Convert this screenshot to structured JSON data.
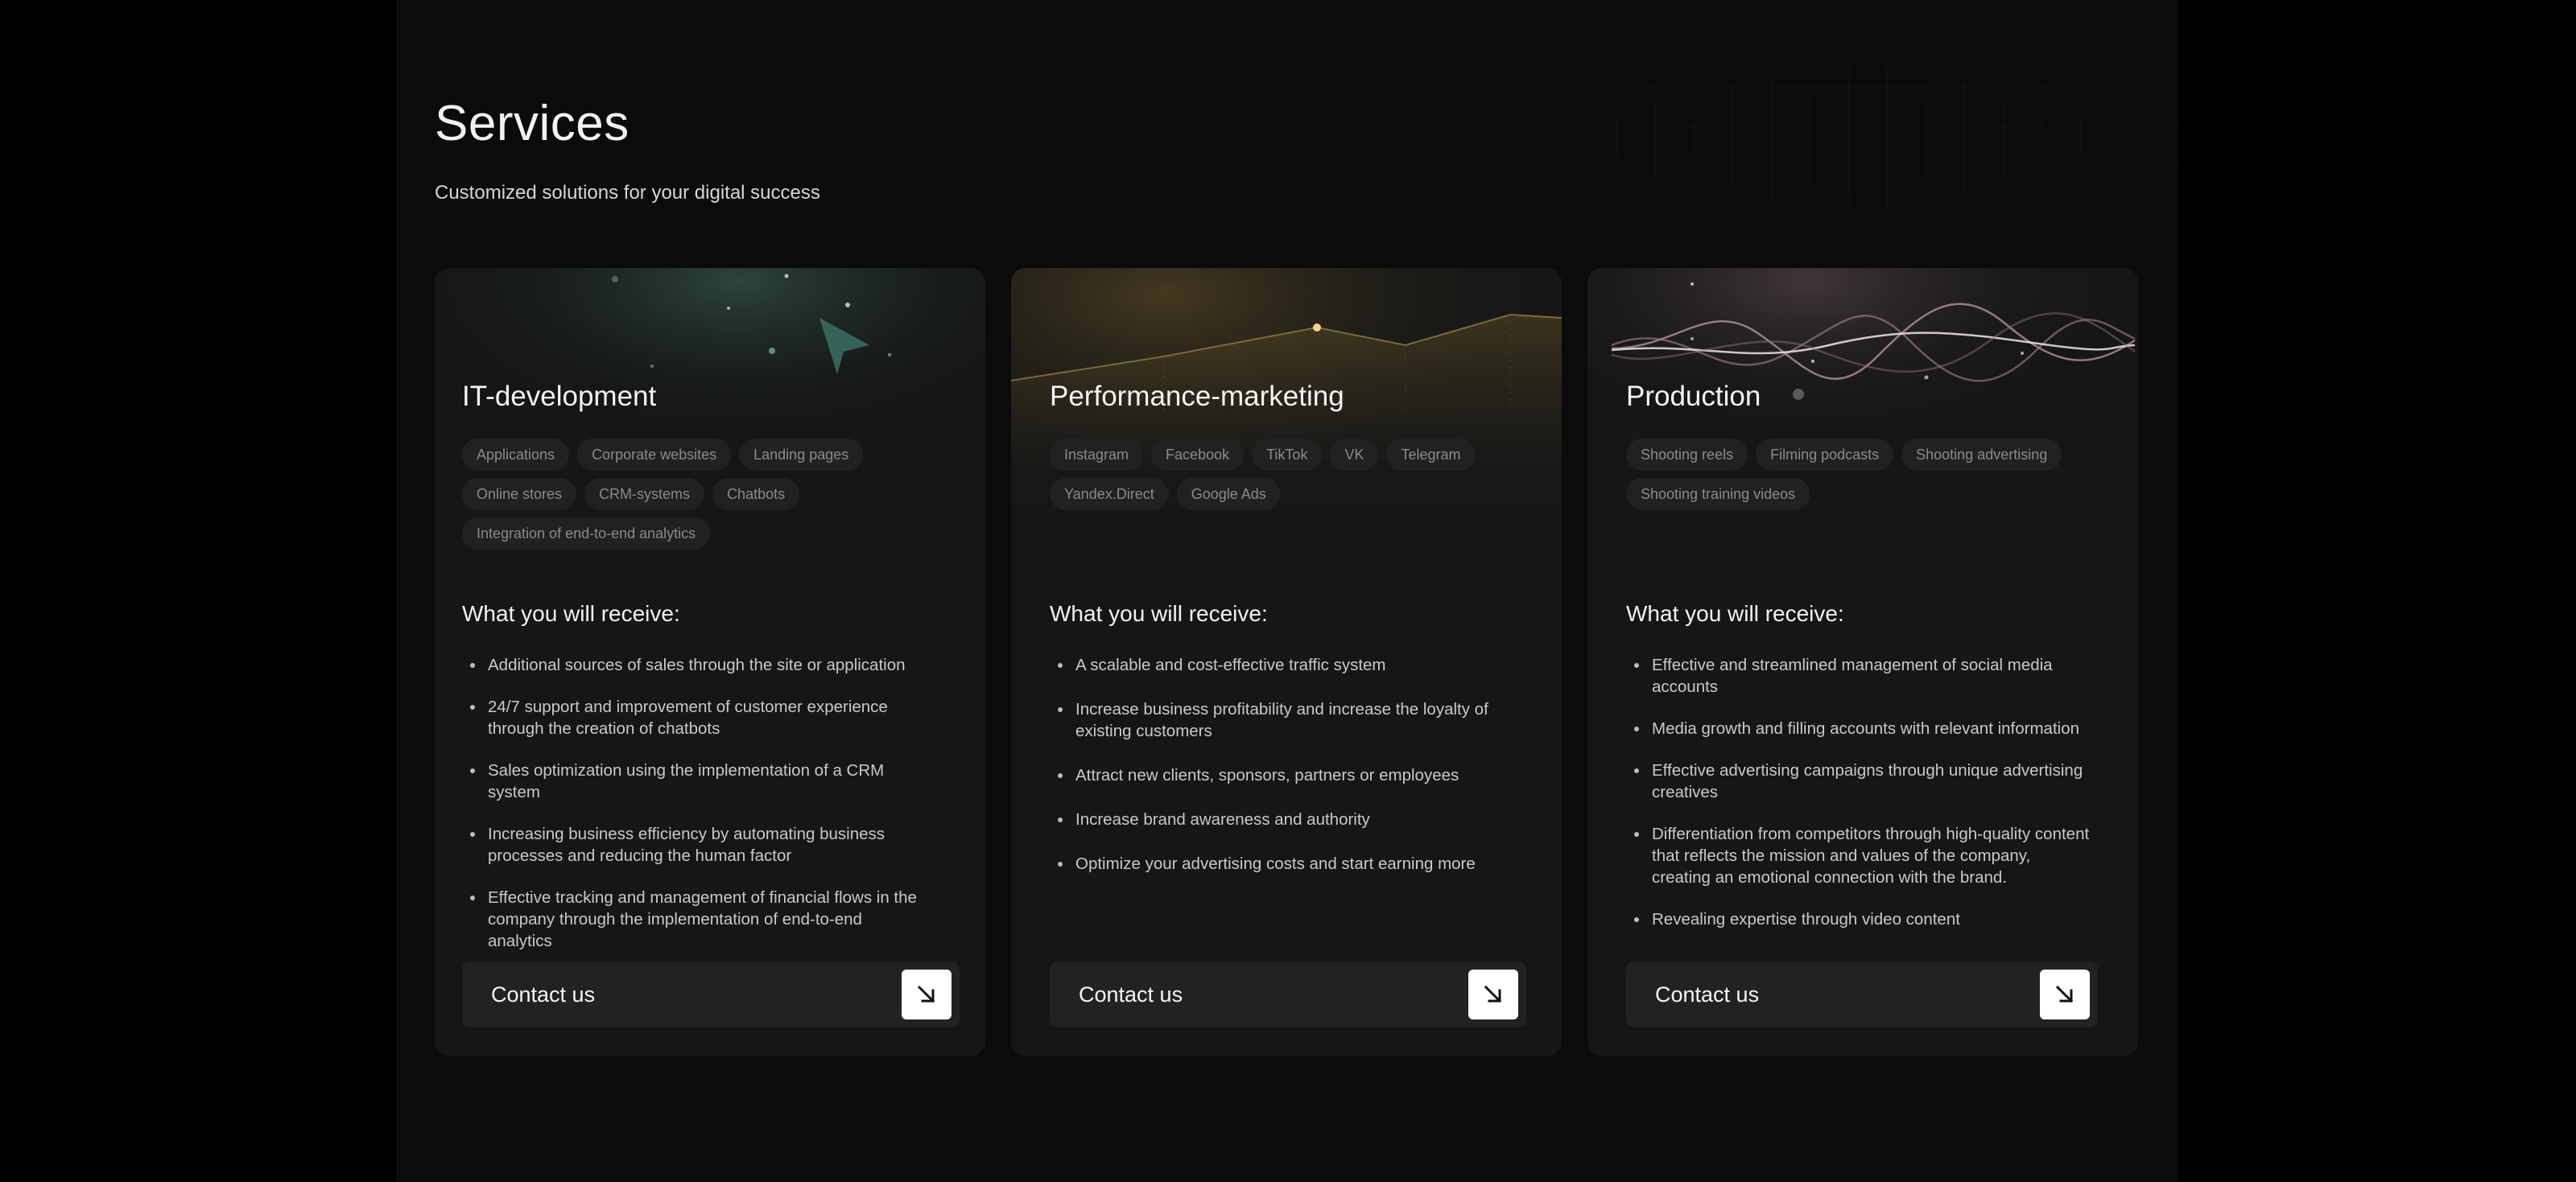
{
  "header": {
    "title": "Services",
    "subtitle": "Customized solutions for your digital success"
  },
  "cards": [
    {
      "title": "IT-development",
      "tags": [
        "Applications",
        "Corporate websites",
        "Landing pages",
        "Online stores",
        "CRM-systems",
        "Chatbots",
        "Integration of end-to-end analytics"
      ],
      "receive_title": "What you will receive:",
      "benefits": [
        "Additional sources of sales through the site or application",
        "24/7 support and improvement of customer experience through the creation of chatbots",
        "Sales optimization using the implementation of a CRM system",
        "Increasing business efficiency by automating business processes and reducing the human factor",
        "Effective tracking and management of financial flows in the company through the implementation of end-to-end analytics"
      ],
      "button": {
        "label": "Contact us",
        "icon": "arrow-down-right-icon"
      }
    },
    {
      "title": "Performance-marketing",
      "tags": [
        "Instagram",
        "Facebook",
        "TikTok",
        "VK",
        "Telegram",
        "Yandex.Direct",
        "Google Ads"
      ],
      "receive_title": "What you will receive:",
      "benefits": [
        "A scalable and cost-effective traffic system",
        "Increase business profitability and increase the loyalty of existing customers",
        "Attract new clients, sponsors, partners or employees",
        "Increase brand awareness and authority",
        "Optimize your advertising costs and start earning more"
      ],
      "button": {
        "label": "Contact us",
        "icon": "arrow-down-right-icon"
      }
    },
    {
      "title": "Production",
      "tags": [
        "Shooting reels",
        "Filming podcasts",
        "Shooting advertising",
        "Shooting training videos"
      ],
      "receive_title": "What you will receive:",
      "benefits": [
        "Effective and streamlined management of social media accounts",
        "Media growth and filling accounts with relevant information",
        "Effective advertising campaigns through unique advertising creatives",
        "Differentiation from competitors through high-quality content that reflects the mission and values of the company, creating an emotional connection with the brand.",
        "Revealing expertise through video content"
      ],
      "button": {
        "label": "Contact us",
        "icon": "arrow-down-right-icon"
      }
    }
  ],
  "colors": {
    "background": "#0b0b0b",
    "card": "#151616",
    "tag": "#202222",
    "button": "#212323",
    "accent_green": "#4f8a78",
    "accent_gold": "#c9a24a",
    "accent_pink": "#c9a0b0"
  }
}
